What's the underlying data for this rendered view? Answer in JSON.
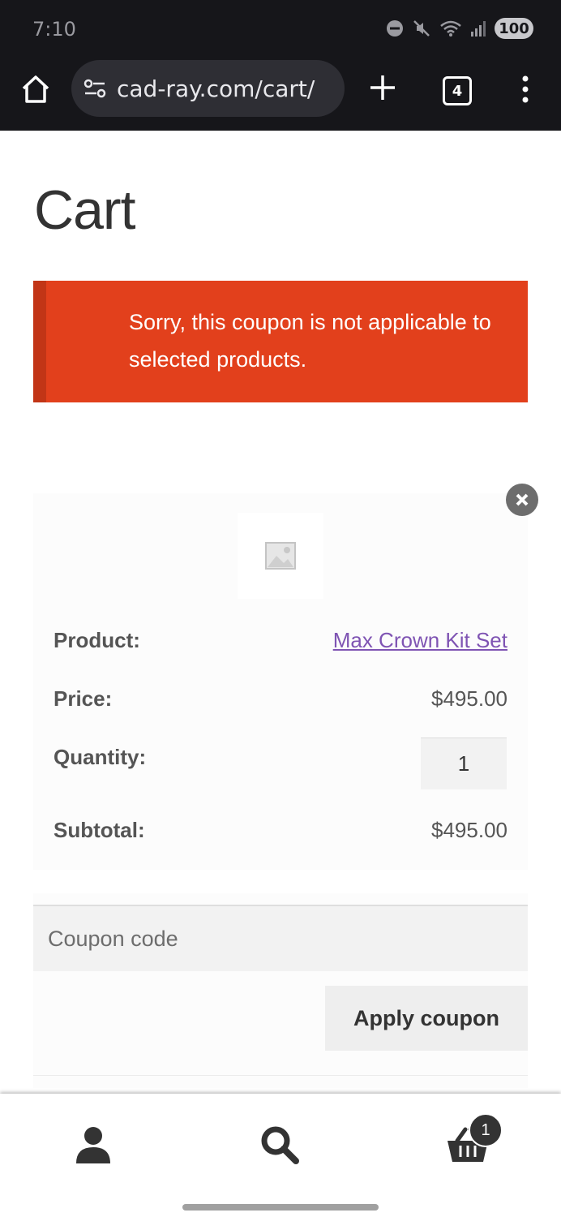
{
  "status_bar": {
    "time": "7:10",
    "battery": "100"
  },
  "browser": {
    "url": "cad-ray.com/cart/",
    "tab_count": "4"
  },
  "page": {
    "title": "Cart"
  },
  "notice": {
    "message": "Sorry, this coupon is not applicable to selected products.",
    "color": "#e2401c"
  },
  "cart_item": {
    "product_label": "Product:",
    "product_name": "Max Crown Kit Set",
    "price_label": "Price:",
    "price": "$495.00",
    "quantity_label": "Quantity:",
    "quantity": "1",
    "subtotal_label": "Subtotal:",
    "subtotal": "$495.00"
  },
  "coupon": {
    "placeholder": "Coupon code",
    "apply_label": "Apply coupon"
  },
  "bottom_nav": {
    "cart_count": "1",
    "items": [
      "account-icon",
      "search-icon",
      "basket-icon"
    ]
  }
}
